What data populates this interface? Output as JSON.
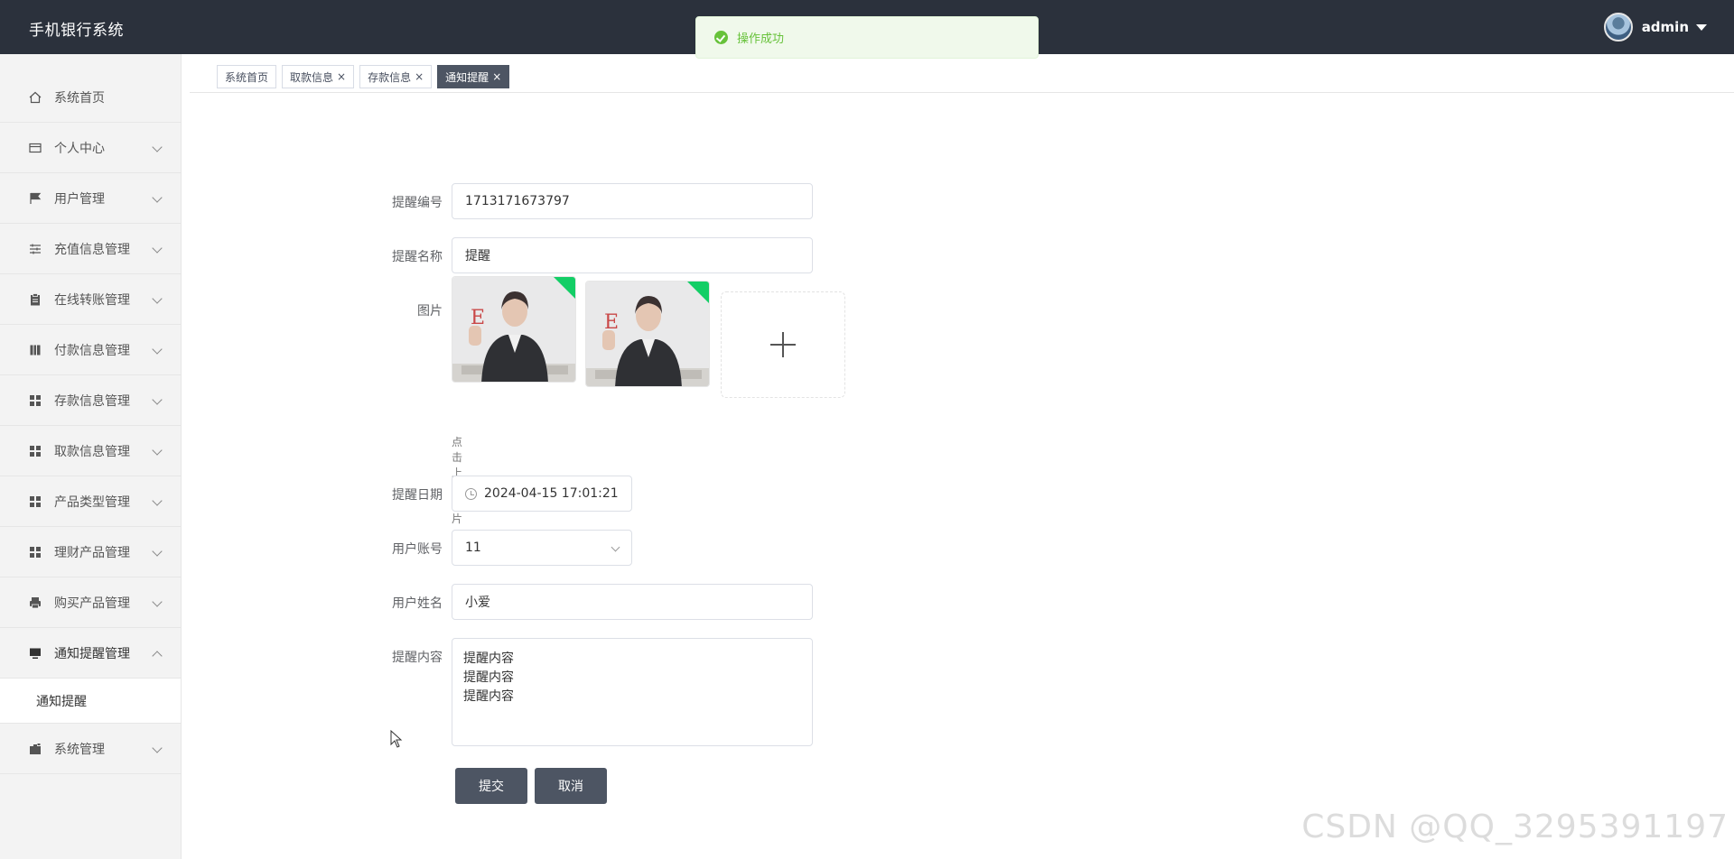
{
  "header": {
    "app_title": "手机银行系统",
    "username": "admin"
  },
  "toast": {
    "message": "操作成功"
  },
  "sidebar": {
    "items": [
      {
        "label": "系统首页",
        "icon": "home-icon"
      },
      {
        "label": "个人中心",
        "icon": "card-icon"
      },
      {
        "label": "用户管理",
        "icon": "flag-icon"
      },
      {
        "label": "充值信息管理",
        "icon": "sliders-icon"
      },
      {
        "label": "在线转账管理",
        "icon": "clipboard-icon"
      },
      {
        "label": "付款信息管理",
        "icon": "book-icon"
      },
      {
        "label": "存款信息管理",
        "icon": "grid-icon"
      },
      {
        "label": "取款信息管理",
        "icon": "grid-icon"
      },
      {
        "label": "产品类型管理",
        "icon": "grid-icon"
      },
      {
        "label": "理财产品管理",
        "icon": "grid-icon"
      },
      {
        "label": "购买产品管理",
        "icon": "printer-icon"
      },
      {
        "label": "通知提醒管理",
        "icon": "monitor-icon"
      },
      {
        "label": "系统管理",
        "icon": "camera-icon"
      }
    ],
    "submenu": {
      "label": "通知提醒"
    }
  },
  "tabs": [
    {
      "label": "系统首页",
      "closable": false
    },
    {
      "label": "取款信息",
      "closable": true
    },
    {
      "label": "存款信息",
      "closable": true
    },
    {
      "label": "通知提醒",
      "closable": true,
      "active": true
    }
  ],
  "tab_close_glyph": "×",
  "form": {
    "reminder_no": {
      "label": "提醒编号",
      "value": "1713171673797"
    },
    "reminder_name": {
      "label": "提醒名称",
      "value": "提醒"
    },
    "picture": {
      "label": "图片",
      "hint": "点击上传图片"
    },
    "reminder_date": {
      "label": "提醒日期",
      "value": "2024-04-15 17:01:21"
    },
    "user_account": {
      "label": "用户账号",
      "value": "11"
    },
    "user_name": {
      "label": "用户姓名",
      "value": "小爱"
    },
    "reminder_content": {
      "label": "提醒内容",
      "value": "提醒内容\n提醒内容\n提醒内容"
    },
    "submit_label": "提交",
    "cancel_label": "取消"
  },
  "watermark": "CSDN @QQ_3295391197",
  "colors": {
    "header_bg": "#2b313c",
    "toast_green": "#67c23a",
    "button_bg": "#4d5563"
  }
}
